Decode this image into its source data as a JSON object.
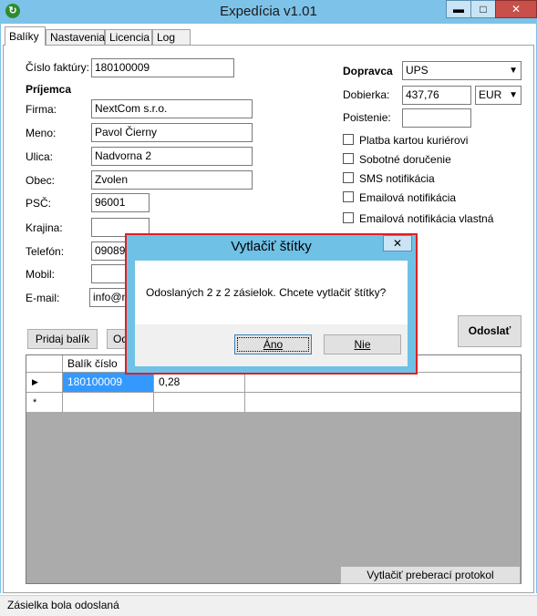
{
  "window": {
    "title": "Expedícia v1.01",
    "app_icon": "refresh-arrow-icon",
    "minimize": "▬",
    "maximize": "□",
    "close": "✕"
  },
  "tabs": [
    {
      "label": "Balíky",
      "active": true
    },
    {
      "label": "Nastavenia",
      "active": false
    },
    {
      "label": "Licencia",
      "active": false
    },
    {
      "label": "Log",
      "active": false
    }
  ],
  "form": {
    "invoice_label": "Číslo faktúry:",
    "invoice_value": "180100009",
    "recipient_heading": "Príjemca",
    "company_label": "Firma:",
    "company_value": "NextCom s.r.o.",
    "name_label": "Meno:",
    "name_value": "Pavol Čierny",
    "street_label": "Ulica:",
    "street_value": "Nadvorna 2",
    "city_label": "Obec:",
    "city_value": "Zvolen",
    "zip_label": "PSČ:",
    "zip_value": "96001",
    "country_label": "Krajina:",
    "country_value": "",
    "phone_label": "Telefón:",
    "phone_value": "090893",
    "mobile_label": "Mobil:",
    "mobile_value": "",
    "email_label": "E-mail:",
    "email_value": "info@ne"
  },
  "shipping": {
    "carrier_label": "Dopravca",
    "carrier_value": "UPS",
    "cod_label": "Dobierka:",
    "cod_value": "437,76",
    "currency_value": "EUR",
    "insurance_label": "Poistenie:",
    "insurance_value": "",
    "options": [
      {
        "label": "Platba kartou kuriérovi",
        "checked": false
      },
      {
        "label": "Sobotné doručenie",
        "checked": false
      },
      {
        "label": "SMS notifikácia",
        "checked": false
      },
      {
        "label": "Emailová notifikácia",
        "checked": false
      },
      {
        "label": "Emailová notifikácia vlastná",
        "checked": false
      }
    ]
  },
  "buttons": {
    "add_package": "Pridaj balík",
    "remove_package": "Od",
    "send": "Odoslať",
    "print_protocol": "Vytlačiť preberací protokol"
  },
  "grid": {
    "columns": [
      "Balík číslo",
      ""
    ],
    "rows": [
      {
        "marker": "▶",
        "cells": [
          "180100009",
          "0,28"
        ]
      },
      {
        "marker": "*",
        "cells": [
          "",
          ""
        ]
      }
    ]
  },
  "dialog": {
    "title": "Vytlačiť štítky",
    "message": "Odoslaných 2 z 2 zásielok. Chcete vytlačiť štítky?",
    "yes_label": "Áno",
    "no_label": "Nie",
    "close": "✕"
  },
  "status": {
    "text": "Zásielka bola odoslaná"
  },
  "colors": {
    "titlebar": "#7dc2e8",
    "dialog_border": "#e31e24",
    "grid_selection": "#3399ff"
  }
}
